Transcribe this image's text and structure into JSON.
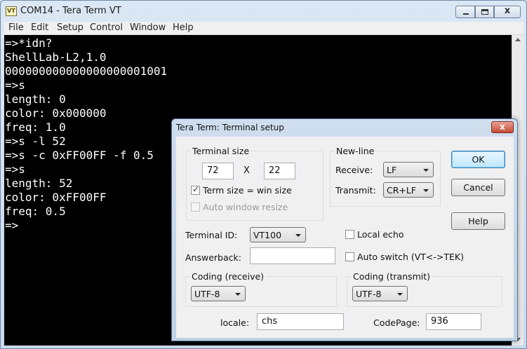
{
  "window": {
    "title": "COM14 - Tera Term VT",
    "icon_text": "VT",
    "menu": [
      "File",
      "Edit",
      "Setup",
      "Control",
      "Window",
      "Help"
    ]
  },
  "terminal": {
    "lines": [
      "=>*idn?",
      "ShellLab-L2,1.0",
      "000000000000000000001001",
      "=>s",
      "length: 0",
      "color: 0x000000",
      "freq: 1.0",
      "=>s -l 52",
      "=>s -c 0xFF00FF -f 0.5",
      "=>s",
      "length: 52",
      "color: 0xFF00FF",
      "freq: 0.5",
      "=>"
    ]
  },
  "dialog": {
    "title": "Tera Term: Terminal setup",
    "close_glyph": "x",
    "terminal_size": {
      "title": "Terminal size",
      "cols": "72",
      "separator": "X",
      "rows": "22",
      "term_size_win_size": "Term size = win size",
      "auto_window_resize": "Auto window resize"
    },
    "newline": {
      "title": "New-line",
      "receive_label": "Receive:",
      "receive_value": "LF",
      "transmit_label": "Transmit:",
      "transmit_value": "CR+LF"
    },
    "buttons": {
      "ok": "OK",
      "cancel": "Cancel",
      "help": "Help"
    },
    "terminal_id_label": "Terminal ID:",
    "terminal_id_value": "VT100",
    "local_echo": "Local echo",
    "answerback_label": "Answerback:",
    "answerback_value": "",
    "auto_switch": "Auto switch (VT<->TEK)",
    "coding_receive": {
      "title": "Coding (receive)",
      "value": "UTF-8"
    },
    "coding_transmit": {
      "title": "Coding (transmit)",
      "value": "UTF-8"
    },
    "locale_label": "locale:",
    "locale_value": "chs",
    "codepage_label": "CodePage:",
    "codepage_value": "936"
  }
}
